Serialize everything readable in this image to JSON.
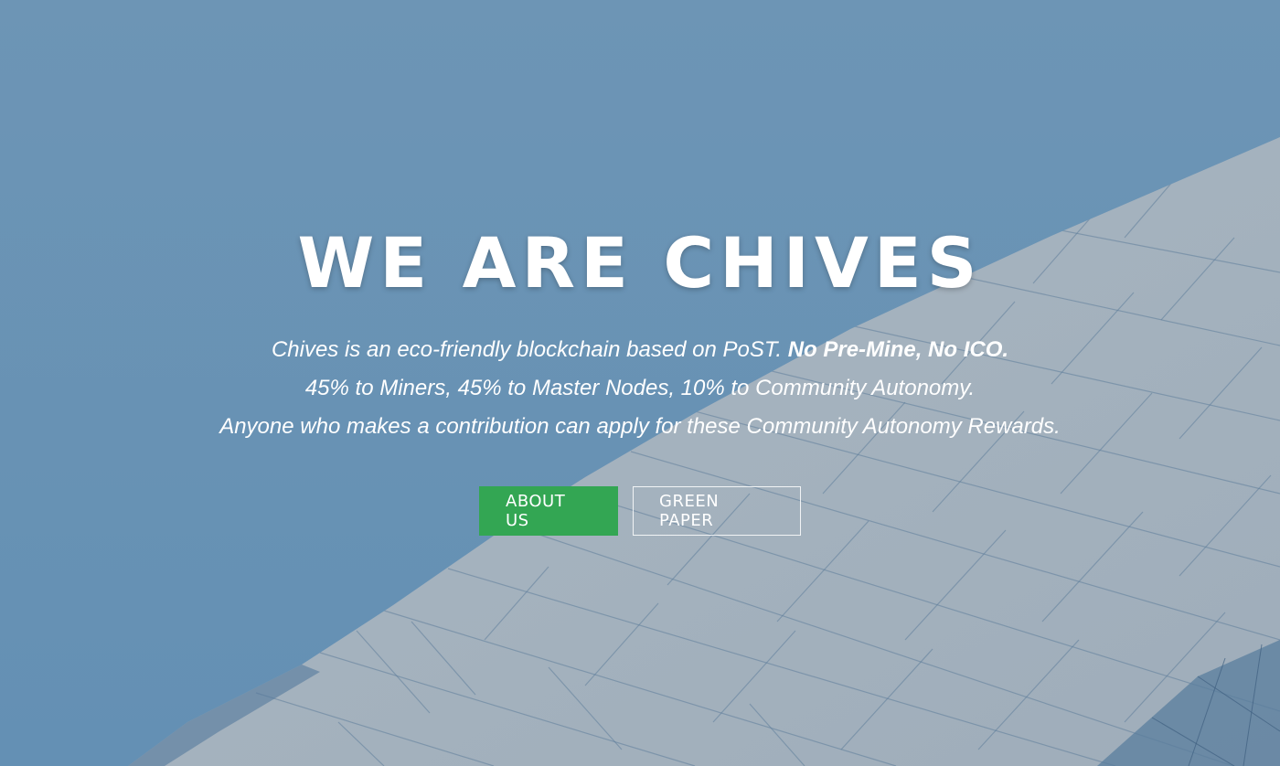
{
  "hero": {
    "title": "WE ARE CHIVES",
    "line1_regular": "Chives is an eco-friendly blockchain based on PoST.",
    "line1_strong": "No Pre-Mine, No ICO.",
    "line2": "45% to Miners, 45% to Master Nodes, 10% to Community Autonomy.",
    "line3": "Anyone who makes a contribution can apply for these Community Autonomy Rewards."
  },
  "buttons": {
    "about_label": "ABOUT US",
    "green_paper_label": "GREEN PAPER"
  },
  "colors": {
    "background_blue": "#6b93b3",
    "building_gray": "#a8b4c0",
    "primary_green": "#33a653",
    "text_white": "#ffffff"
  }
}
